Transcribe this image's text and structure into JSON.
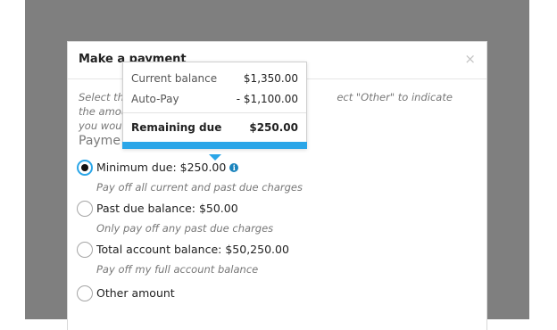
{
  "modal": {
    "title": "Make a payment",
    "close_glyph": "×",
    "instructions_left": "Select the",
    "instructions_right": "ect \"Other\" to indicate the amount",
    "instructions_line2": "you would",
    "section_label": "Payme"
  },
  "tooltip": {
    "rows": [
      {
        "label": "Current balance",
        "value": "$1,350.00"
      },
      {
        "label": "Auto-Pay",
        "value": "- $1,100.00"
      }
    ],
    "total": {
      "label": "Remaining due",
      "value": "$250.00"
    },
    "accent_color": "#2ba6e8"
  },
  "options": [
    {
      "label": "Minimum due: $250.00",
      "description": "Pay off all current and past due charges",
      "selected": true,
      "has_info_icon": true
    },
    {
      "label": "Past due balance: $50.00",
      "description": "Only pay off any past due charges",
      "selected": false
    },
    {
      "label": "Total account balance: $50,250.00",
      "description": "Pay off my full account balance",
      "selected": false
    },
    {
      "label": "Other amount",
      "description": "",
      "selected": false
    }
  ],
  "icons": {
    "info": "i",
    "close": "close-icon"
  },
  "colors": {
    "backdrop": "#7f7f7f",
    "accent": "#2ba6e8",
    "info_icon": "#1b84bd"
  }
}
